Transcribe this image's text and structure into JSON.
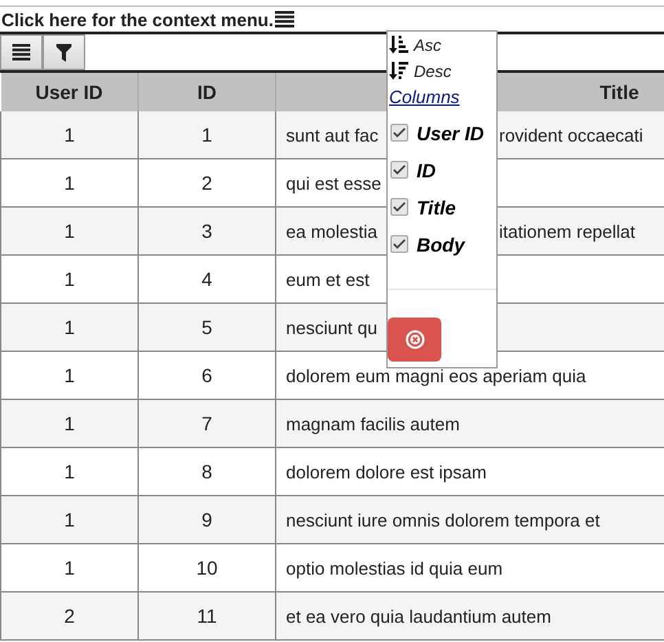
{
  "caption": "Click here for the context menu.",
  "toolbar": {
    "buttons": [
      {
        "kind": "menu"
      },
      {
        "kind": "filter"
      }
    ]
  },
  "table": {
    "columns": [
      "User ID",
      "ID",
      "Title"
    ],
    "rows": [
      {
        "cells": [
          "1",
          "1"
        ],
        "title": [
          "sunt aut fac",
          "rovident occaecati"
        ]
      },
      {
        "cells": [
          "1",
          "2"
        ],
        "title": [
          "qui est esse"
        ]
      },
      {
        "cells": [
          "1",
          "3"
        ],
        "title": [
          "ea molestia",
          "itationem repellat"
        ]
      },
      {
        "cells": [
          "1",
          "4"
        ],
        "title": [
          "eum et est"
        ]
      },
      {
        "cells": [
          "1",
          "5"
        ],
        "title": [
          "nesciunt qu"
        ]
      },
      {
        "cells": [
          "1",
          "6"
        ],
        "title": [
          "dolorem eum magni eos aperiam quia"
        ]
      },
      {
        "cells": [
          "1",
          "7"
        ],
        "title": [
          "magnam facilis autem"
        ]
      },
      {
        "cells": [
          "1",
          "8"
        ],
        "title": [
          "dolorem dolore est ipsam"
        ]
      },
      {
        "cells": [
          "1",
          "9"
        ],
        "title": [
          "nesciunt iure omnis dolorem tempora et"
        ]
      },
      {
        "cells": [
          "1",
          "10"
        ],
        "title": [
          "optio molestias id quia eum"
        ]
      },
      {
        "cells": [
          "2",
          "11"
        ],
        "title": [
          "et ea vero quia laudantium autem"
        ]
      }
    ]
  },
  "context_menu": {
    "sort": [
      {
        "kind": "asc",
        "label": "Asc"
      },
      {
        "kind": "desc",
        "label": "Desc"
      }
    ],
    "columns_link": "Columns",
    "columns": [
      {
        "label": "User ID",
        "checked": true
      },
      {
        "label": "ID",
        "checked": true
      },
      {
        "label": "Title",
        "checked": true
      },
      {
        "label": "Body",
        "checked": true
      }
    ],
    "buttons": [
      {
        "kind": "close"
      }
    ]
  }
}
